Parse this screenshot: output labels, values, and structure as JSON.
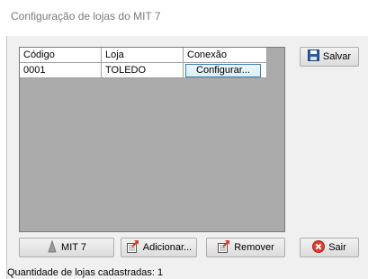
{
  "window": {
    "title": "Configuração de lojas do MIT 7"
  },
  "grid": {
    "headers": [
      "Código",
      "Loja",
      "Conexão"
    ],
    "rows": [
      {
        "codigo": "0001",
        "loja": "TOLEDO",
        "conexao_button": "Configurar..."
      }
    ]
  },
  "buttons": {
    "salvar": "Salvar",
    "mit": "MIT 7",
    "adicionar": "Adicionar...",
    "remover": "Remover",
    "sair": "Sair"
  },
  "status": {
    "text": "Quantidade de lojas cadastradas: 1"
  },
  "icons": {
    "salvar": "floppy-disk-icon",
    "mit": "mit-gray-icon",
    "adicionar": "add-document-icon",
    "remover": "remove-document-icon",
    "sair": "red-x-circle-icon"
  },
  "colors": {
    "grid_background": "#ababab",
    "selected_button_border": "#3c7fb1",
    "exit_icon": "#e53b2e"
  }
}
